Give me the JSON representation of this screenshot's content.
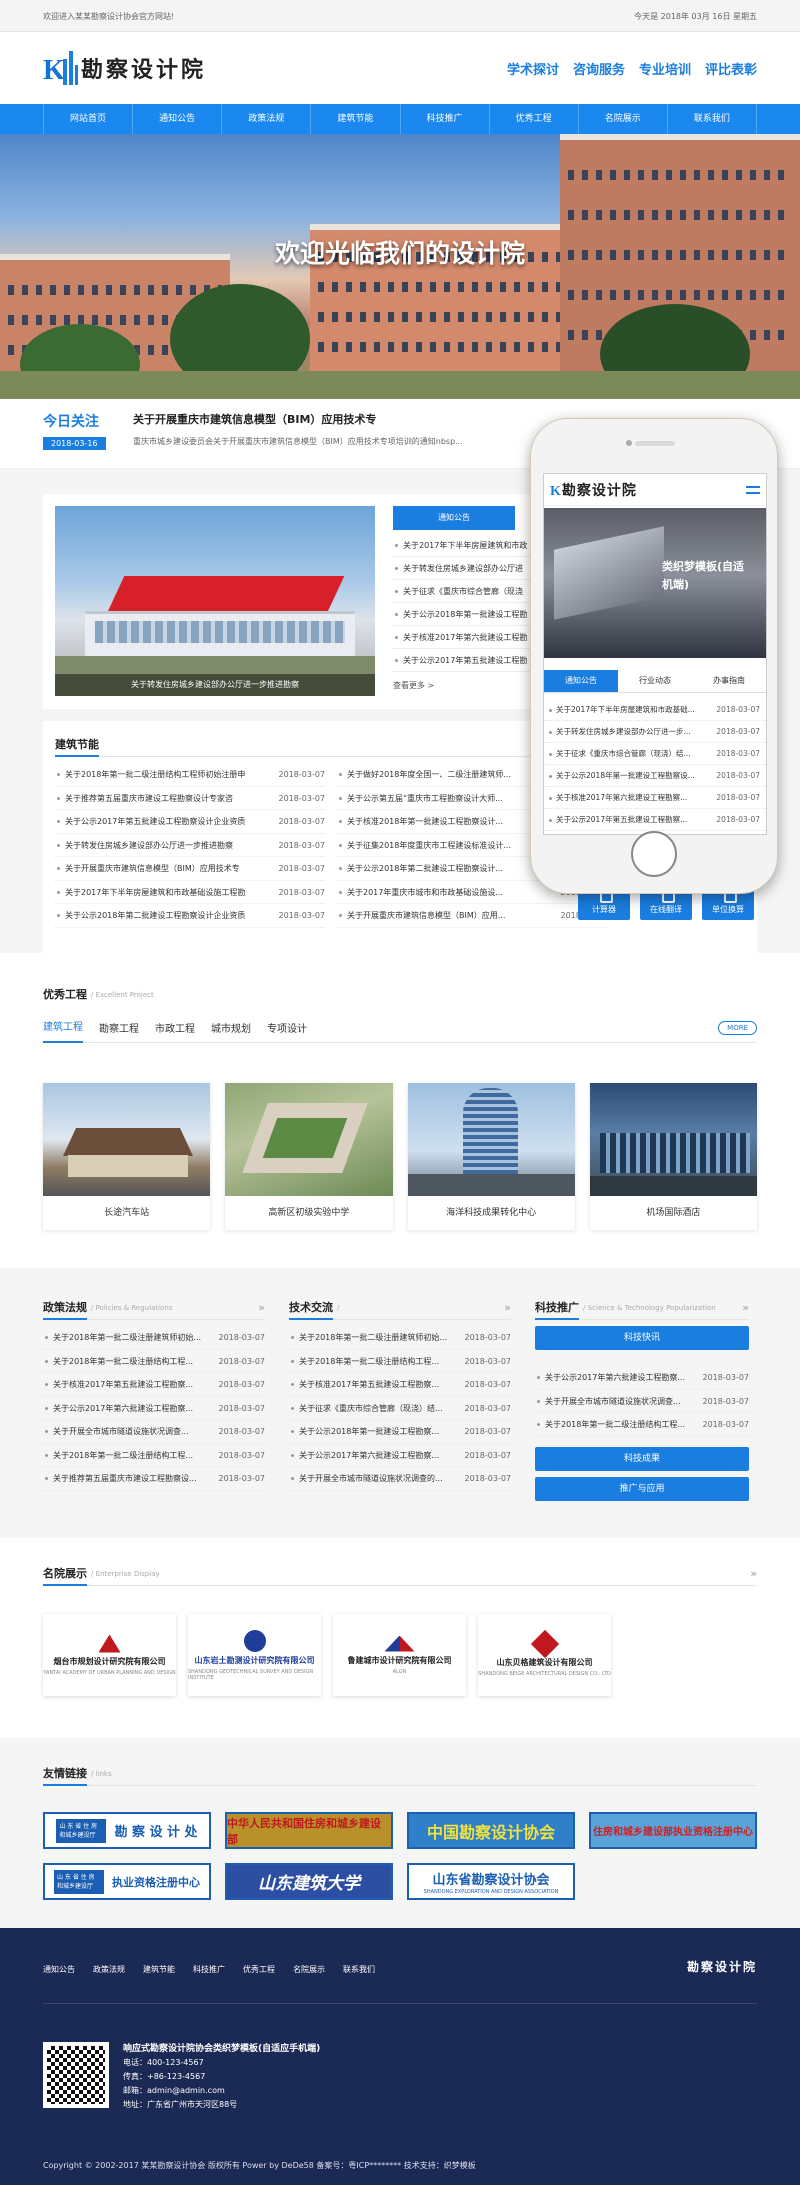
{
  "topbar": {
    "welcome": "欢迎进入某某勘察设计协会官方网站!",
    "date": "今天是 2018年 03月 16日 星期五"
  },
  "header": {
    "logo_letter": "K",
    "logo_text": "勘察设计院",
    "links": [
      "学术探讨",
      "咨询服务",
      "专业培训",
      "评比表彰"
    ]
  },
  "nav": [
    "网站首页",
    "通知公告",
    "政策法规",
    "建筑节能",
    "科技推广",
    "优秀工程",
    "名院展示",
    "联系我们"
  ],
  "banner": {
    "title": "欢迎光临我们的设计院"
  },
  "today": {
    "heading": "今日关注",
    "date": "2018-03-16",
    "title": "关于开展重庆市建筑信息模型（BIM）应用技术专",
    "desc": "重庆市城乡建设委员会关于开展重庆市建筑信息模型（BIM）应用技术专项培训的通知nbsp..."
  },
  "featured": {
    "caption": "关于转发住房城乡建设部办公厅进一步推进勘察",
    "tab": "通知公告",
    "more": "查看更多 >",
    "items": [
      "关于2017年下半年房屋建筑和市政",
      "关于转发住房城乡建设部办公厅进",
      "关于征求《重庆市综合管廊（现浇",
      "关于公示2018年第一批建设工程勘",
      "关于核准2017年第六批建设工程勘",
      "关于公示2017年第五批建设工程勘"
    ]
  },
  "energy": {
    "title": "建筑节能",
    "rows": [
      {
        "t": "关于2018年第一批二级注册结构工程师初始注册申",
        "d": "2018-03-07"
      },
      {
        "t": "关于做好2018年度全国一、二级注册建筑师...",
        "d": "2018-03-07"
      },
      {
        "t": "关于推荐第五届重庆市建设工程勘察设计专家咨",
        "d": "2018-03-07"
      },
      {
        "t": "关于公示第五届“重庆市工程勘察设计大师...",
        "d": "2018-03-07"
      },
      {
        "t": "关于公示2017年第五批建设工程勘察设计企业资质",
        "d": "2018-03-07"
      },
      {
        "t": "关于核准2018年第一批建设工程勘察设计...",
        "d": "2018-03-07"
      },
      {
        "t": "关于转发住房城乡建设部办公厅进一步推进勘察",
        "d": "2018-03-07"
      },
      {
        "t": "关于征集2018年度重庆市工程建设标准设计...",
        "d": "2018-03-07"
      },
      {
        "t": "关于开展重庆市建筑信息模型（BIM）应用技术专",
        "d": "2018-03-07"
      },
      {
        "t": "关于公示2018年第二批建设工程勘察设计...",
        "d": "2018-03-07"
      },
      {
        "t": "关于2017年下半年房屋建筑和市政基础设施工程勘",
        "d": "2018-03-07"
      },
      {
        "t": "关于2017年重庆市城市和市政基础设施设...",
        "d": "2018-03-07"
      },
      {
        "t": "关于公示2018年第二批建设工程勘察设计企业资质",
        "d": "2018-03-07"
      },
      {
        "t": "关于开展重庆市建筑信息模型（BIM）应用...",
        "d": "2018-03-07"
      }
    ],
    "buttons": [
      "计算器",
      "在线翻译",
      "单位换算"
    ]
  },
  "projects": {
    "title": "优秀工程",
    "en": "/ Excellent Project",
    "tabs": [
      "建筑工程",
      "勘察工程",
      "市政工程",
      "城市规划",
      "专项设计"
    ],
    "more": "MORE",
    "items": [
      "长途汽车站",
      "高新区初级实验中学",
      "海洋科技成果转化中心",
      "机场国际酒店"
    ]
  },
  "policy": {
    "title": "政策法规",
    "en": "/ Policies & Regulations",
    "rows": [
      {
        "t": "关于2018年第一批二级注册建筑师初始...",
        "d": "2018-03-07"
      },
      {
        "t": "关于2018年第一批二级注册结构工程...",
        "d": "2018-03-07"
      },
      {
        "t": "关于核准2017年第五批建设工程勘察...",
        "d": "2018-03-07"
      },
      {
        "t": "关于公示2017年第六批建设工程勘察...",
        "d": "2018-03-07"
      },
      {
        "t": "关于开展全市城市隧道设施状况调查...",
        "d": "2018-03-07"
      },
      {
        "t": "关于2018年第一批二级注册结构工程...",
        "d": "2018-03-07"
      },
      {
        "t": "关于推荐第五届重庆市建设工程勘察设...",
        "d": "2018-03-07"
      }
    ]
  },
  "tech": {
    "title": "技术交流",
    "en": "/",
    "rows": [
      {
        "t": "关于2018年第一批二级注册建筑师初始...",
        "d": "2018-03-07"
      },
      {
        "t": "关于2018年第一批二级注册结构工程...",
        "d": "2018-03-07"
      },
      {
        "t": "关于核准2017年第五批建设工程勘察...",
        "d": "2018-03-07"
      },
      {
        "t": "关于征求《重庆市综合管廊（现浇）结...",
        "d": "2018-03-07"
      },
      {
        "t": "关于公示2018年第一批建设工程勘察...",
        "d": "2018-03-07"
      },
      {
        "t": "关于公示2017年第六批建设工程勘察...",
        "d": "2018-03-07"
      },
      {
        "t": "关于开展全市城市隧道设施状况调查的...",
        "d": "2018-03-07"
      }
    ]
  },
  "promo": {
    "title": "科技推广",
    "en": "/ Science & Technology Popularization",
    "btn1": "科技快讯",
    "btn2": "科技成果",
    "btn3": "推广与应用",
    "rows": [
      {
        "t": "关于公示2017年第六批建设工程勘察...",
        "d": "2018-03-07"
      },
      {
        "t": "关于开展全市城市隧道设施状况调查...",
        "d": "2018-03-07"
      },
      {
        "t": "关于2018年第一批二级注册结构工程...",
        "d": "2018-03-07"
      }
    ]
  },
  "enterprise": {
    "title": "名院展示",
    "en": "/ Enterprise Display",
    "items": [
      {
        "name": "烟台市规划设计研究院有限公司",
        "en": "YANTAI ACADEMY OF URBAN PLANNING AND DESIGN"
      },
      {
        "name": "山东岩土勘测设计研究院有限公司",
        "en": "SHANDONG GEOTECHNICAL SURVEY AND DESIGN INSTITUTE"
      },
      {
        "name": "鲁建城市设计研究院有限公司",
        "en": "ALGN"
      },
      {
        "name": "山东贝格建筑设计有限公司",
        "en": "SHANDONG BEIGE ARCHITECTURAL DESIGN CO., LTD"
      }
    ]
  },
  "friends": {
    "title": "友情链接",
    "en": "/ links",
    "items": [
      {
        "text": "勘 察 设 计 处",
        "sub": "山 东 省 住 房 和城乡建设厅",
        "bg": "#ffffff",
        "fg": "#1a5fb4"
      },
      {
        "text": "中华人民共和国住房和城乡建设部",
        "sub": "",
        "bg": "#b8912a",
        "fg": "#c0181f"
      },
      {
        "text": "中国勘察设计协会",
        "sub": "",
        "bg": "#2f7fc9",
        "fg": "#f2e23a"
      },
      {
        "text": "住房和城乡建设部执业资格注册中心",
        "sub": "",
        "bg": "#5aa3d9",
        "fg": "#d41d1d"
      },
      {
        "text": "执业资格注册中心",
        "sub": "山 东 省 住 房 和城乡建设厅",
        "bg": "#ffffff",
        "fg": "#1a5fb4"
      },
      {
        "text": "山东建筑大学",
        "sub": "",
        "bg": "#2c4fa3",
        "fg": "#ffffff"
      },
      {
        "text": "山东省勘察设计协会",
        "sub": "SHANDONG EXPLORATION AND DESIGN ASSOCIATION",
        "bg": "#ffffff",
        "fg": "#1a5fb4"
      }
    ]
  },
  "footer": {
    "nav": [
      "通知公告",
      "政策法规",
      "建筑节能",
      "科技推广",
      "优秀工程",
      "名院展示",
      "联系我们"
    ],
    "logo": "勘察设计院",
    "name": "响应式勘察设计院协会类织梦模板(自适应手机端)",
    "phone": "电话：400-123-4567",
    "fax": "传真：+86-123-4567",
    "email": "邮箱：admin@admin.com",
    "addr": "地址：广东省广州市天河区88号",
    "copyright": "Copyright © 2002-2017 某某勘察设计协会 版权所有 Power by DeDe58 备案号：粤ICP******** 技术支持：织梦模板"
  },
  "phone": {
    "logo_letter": "K",
    "logo_text": "勘察设计院",
    "banner": "类织梦模板(自适\n机端)",
    "tabs": [
      "通知公告",
      "行业动态",
      "办事指南"
    ],
    "rows": [
      {
        "t": "关于2017年下半年房屋建筑和市政基础...",
        "d": "2018-03-07"
      },
      {
        "t": "关于转发住房城乡建设部办公厅进一步...",
        "d": "2018-03-07"
      },
      {
        "t": "关于征求《重庆市综合管廊（现浇）结...",
        "d": "2018-03-07"
      },
      {
        "t": "关于公示2018年第一批建设工程勘察设...",
        "d": "2018-03-07"
      },
      {
        "t": "关于核准2017年第六批建设工程勘察...",
        "d": "2018-03-07"
      },
      {
        "t": "关于公示2017年第五批建设工程勘察...",
        "d": "2018-03-07"
      }
    ]
  }
}
